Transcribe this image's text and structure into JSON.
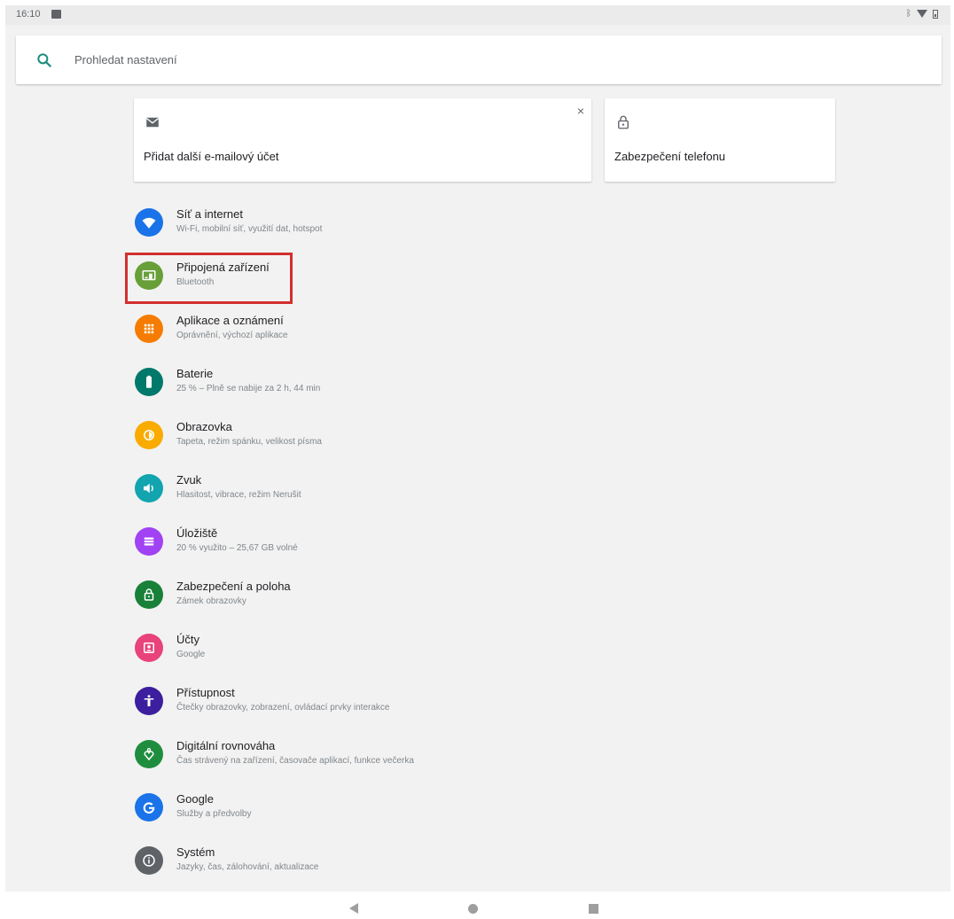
{
  "status_bar": {
    "time": "16:10"
  },
  "search": {
    "placeholder": "Prohledat nastavení"
  },
  "suggestions": [
    {
      "label": "Přidat další e-mailový účet",
      "icon": "email-icon",
      "dismiss": "×"
    },
    {
      "label": "Zabezpečení telefonu",
      "icon": "lock-icon"
    }
  ],
  "settings": [
    {
      "title": "Síť a internet",
      "subtitle": "Wi-Fi, mobilní síť, využití dat, hotspot",
      "color": "#1a73e8",
      "icon": "wifi-icon"
    },
    {
      "title": "Připojená zařízení",
      "subtitle": "Bluetooth",
      "color": "#689f38",
      "icon": "connected-devices-icon"
    },
    {
      "title": "Aplikace a oznámení",
      "subtitle": "Oprávnění, výchozí aplikace",
      "color": "#f57c00",
      "icon": "apps-icon"
    },
    {
      "title": "Baterie",
      "subtitle": "25 % – Plně se nabije za 2 h, 44 min",
      "color": "#00796b",
      "icon": "battery-icon"
    },
    {
      "title": "Obrazovka",
      "subtitle": "Tapeta, režim spánku, velikost písma",
      "color": "#f9ab00",
      "icon": "display-icon"
    },
    {
      "title": "Zvuk",
      "subtitle": "Hlasitost, vibrace, režim Nerušit",
      "color": "#12a4af",
      "icon": "sound-icon"
    },
    {
      "title": "Úložiště",
      "subtitle": "20 % využito – 25,67 GB volné",
      "color": "#a142f4",
      "icon": "storage-icon"
    },
    {
      "title": "Zabezpečení a poloha",
      "subtitle": "Zámek obrazovky",
      "color": "#188038",
      "icon": "lock-icon"
    },
    {
      "title": "Účty",
      "subtitle": "Google",
      "color": "#e8437a",
      "icon": "account-icon"
    },
    {
      "title": "Přístupnost",
      "subtitle": "Čtečky obrazovky, zobrazení, ovládací prvky interakce",
      "color": "#3c1e9e",
      "icon": "accessibility-icon"
    },
    {
      "title": "Digitální rovnováha",
      "subtitle": "Čas strávený na zařízení, časovače aplikací, funkce večerka",
      "color": "#1e8e3e",
      "icon": "wellbeing-icon"
    },
    {
      "title": "Google",
      "subtitle": "Služby a předvolby",
      "color": "#1a73e8",
      "icon": "google-icon"
    },
    {
      "title": "Systém",
      "subtitle": "Jazyky, čas, zálohování, aktualizace",
      "color": "#5f6368",
      "icon": "info-icon"
    }
  ],
  "highlighted_item": "Připojená zařízení"
}
